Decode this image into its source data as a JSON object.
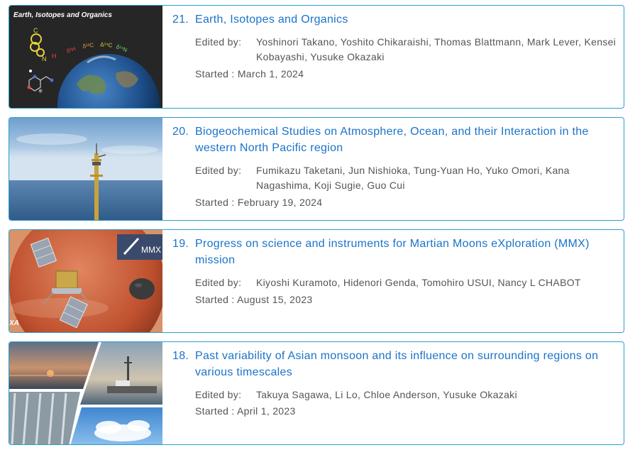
{
  "items": [
    {
      "number": "21.",
      "title": "Earth, Isotopes and Organics",
      "thumb_caption": "Earth, Isotopes and Organics",
      "thumb_symbols": [
        "δ²H",
        "δ¹³C",
        "Δ¹⁴C",
        "δ¹⁵N"
      ],
      "edited_label": "Edited by:",
      "editors": "Yoshinori Takano, Yoshito Chikaraishi, Thomas Blattmann, Mark Lever, Kensei Kobayashi, Yusuke Okazaki",
      "started_label": "Started :",
      "started_date": "March 1, 2024"
    },
    {
      "number": "20.",
      "title": "Biogeochemical Studies on Atmosphere, Ocean, and their Interaction in the western North Pacific region",
      "edited_label": "Edited by:",
      "editors": "Fumikazu Taketani, Jun Nishioka, Tung-Yuan Ho, Yuko Omori, Kana Nagashima, Koji Sugie, Guo Cui",
      "started_label": "Started :",
      "started_date": "February 19, 2024"
    },
    {
      "number": "19.",
      "title": "Progress on science and instruments for Martian Moons eXploration (MMX) mission",
      "thumb_logo": "MMX",
      "thumb_corner": "XA",
      "edited_label": "Edited by:",
      "editors": "Kiyoshi Kuramoto, Hidenori Genda, Tomohiro USUI, Nancy L CHABOT",
      "started_label": "Started :",
      "started_date": "August 15, 2023"
    },
    {
      "number": "18.",
      "title": "Past variability of Asian monsoon and its influence on surrounding regions on various timescales",
      "edited_label": "Edited by:",
      "editors": "Takuya Sagawa, Li Lo, Chloe Anderson, Yusuke Okazaki",
      "started_label": "Started :",
      "started_date": "April 1, 2023"
    }
  ],
  "colors": {
    "border": "#2a9fcf",
    "link": "#1a73c8",
    "meta_text": "#555555"
  }
}
